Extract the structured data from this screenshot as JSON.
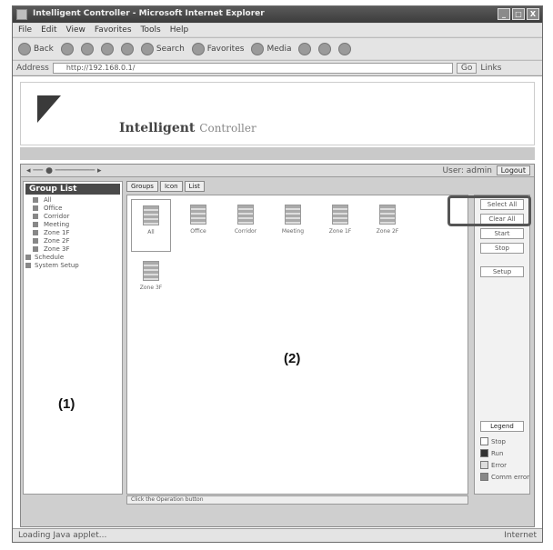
{
  "window": {
    "title": "Intelligent Controller - Microsoft Internet Explorer",
    "buttons": [
      "_",
      "□",
      "X"
    ]
  },
  "menubar": [
    "File",
    "Edit",
    "View",
    "Favorites",
    "Tools",
    "Help"
  ],
  "toolbar": {
    "back": "Back",
    "search": "Search",
    "favorites": "Favorites",
    "media": "Media"
  },
  "addressbar": {
    "label": "Address",
    "url": "http://192.168.0.1/",
    "go": "Go",
    "links": "Links"
  },
  "banner": {
    "product": "Intelligent",
    "product_suffix": "Controller"
  },
  "app": {
    "user_text": "User: admin",
    "logout": "Logout",
    "tree": {
      "root": "Group List",
      "items": [
        "All",
        "Office",
        "Corridor",
        "Meeting",
        "Zone 1F",
        "Zone 2F",
        "Zone 3F"
      ],
      "extra": [
        "Schedule",
        "System Setup"
      ]
    },
    "tabs": [
      "Groups",
      "Icon",
      "List"
    ],
    "groups": [
      "All",
      "Office",
      "Corridor",
      "Meeting",
      "Zone 1F",
      "Zone 2F",
      "Zone 3F"
    ],
    "side_buttons": [
      "Select All",
      "Clear All",
      "Start",
      "Stop",
      "Setup"
    ],
    "legend_button": "Legend",
    "legend": [
      {
        "label": "Stop",
        "color": "#ffffff"
      },
      {
        "label": "Run",
        "color": "#333333"
      },
      {
        "label": "Error",
        "color": "#dddddd"
      },
      {
        "label": "Comm error",
        "color": "#888888"
      }
    ],
    "status": "Click the Operation button"
  },
  "annotations": {
    "label_1": "(1)",
    "label_2": "(2)"
  },
  "statusbar": {
    "left": "Loading Java applet...",
    "right": "Internet"
  }
}
